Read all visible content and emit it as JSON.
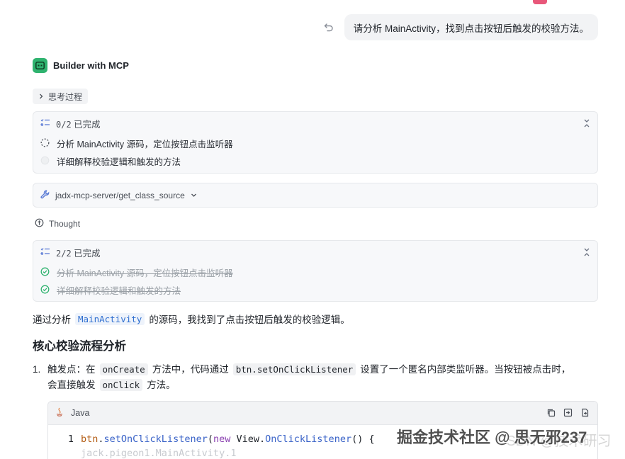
{
  "user_message": {
    "text": "请分析 MainActivity，找到点击按钮后触发的校验方法。"
  },
  "agent": {
    "name": "Builder with MCP"
  },
  "thinking_toggle": {
    "label": "思考过程"
  },
  "task_list_1": {
    "count": "0/2",
    "status": "已完成",
    "items": [
      {
        "text": "分析 MainActivity 源码，定位按钮点击监听器",
        "state": "in-progress"
      },
      {
        "text": "详细解释校验逻辑和触发的方法",
        "state": "pending"
      }
    ]
  },
  "tool_call": {
    "name": "jadx-mcp-server/get_class_source"
  },
  "thought": {
    "label": "Thought"
  },
  "task_list_2": {
    "count": "2/2",
    "status": "已完成",
    "items": [
      {
        "text": "分析 MainActivity 源码，定位按钮点击监听器",
        "state": "done"
      },
      {
        "text": "详细解释校验逻辑和触发的方法",
        "state": "done"
      }
    ]
  },
  "paragraph": {
    "prefix": "通过分析",
    "code": "MainActivity",
    "suffix": "的源码，我找到了点击按钮后触发的校验逻辑。"
  },
  "heading": "核心校验流程分析",
  "list": {
    "num": "1.",
    "p1": "触发点：在",
    "c1": "onCreate",
    "p2": "方法中，代码通过",
    "c2": "btn.setOnClickListener",
    "p3": "设置了一个匿名内部类监听器。当按钮被点击时，",
    "p4": "会直接触发",
    "c3": "onClick",
    "p5": "方法。"
  },
  "code_block": {
    "language": "Java",
    "line_no": "1",
    "tokens": {
      "var": "btn",
      "dot1": ".",
      "fn": "setOnClickListener",
      "paren": "(",
      "kw": "new",
      "cls": " View.",
      "fn2": "OnClickListener",
      "rest": "() {"
    },
    "line2": "jack.pigeon1.MainActivity.1"
  },
  "watermark": {
    "text": "掘金技术社区 @ 思无邪237",
    "ghost": "CSDN @技术研习"
  },
  "colors": {
    "accent_green": "#2fb36f",
    "code_blue": "#2f6fd0"
  }
}
